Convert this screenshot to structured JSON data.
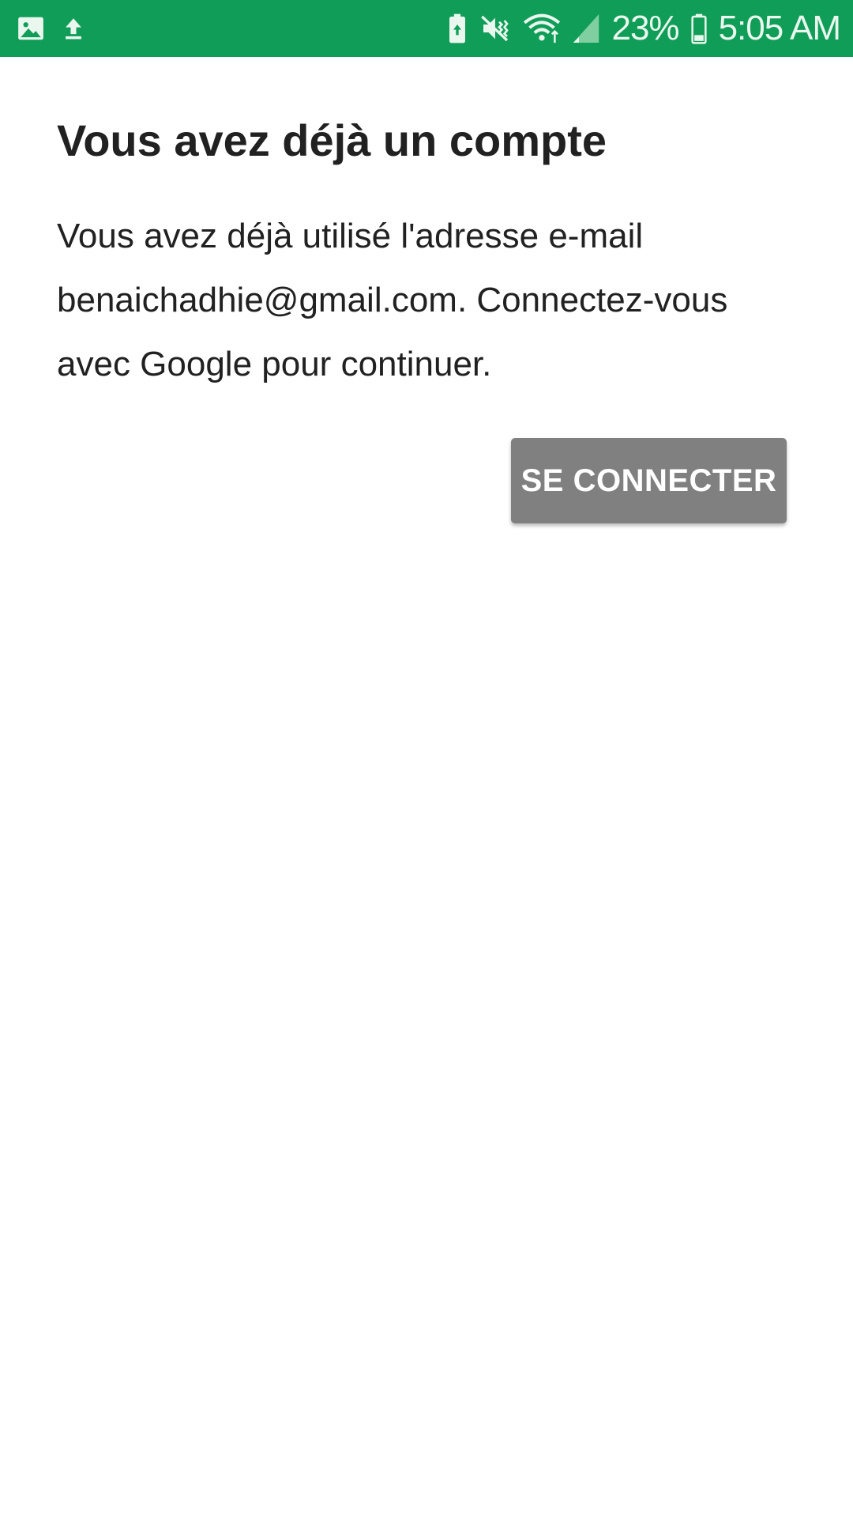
{
  "status_bar": {
    "background_color": "#109d58",
    "left_icons": [
      "gallery-icon",
      "upload-icon"
    ],
    "right_icons": [
      "battery-saver-icon",
      "mute-vibrate-icon",
      "wifi-icon",
      "signal-icon",
      "battery-icon"
    ],
    "battery_percent": "23%",
    "time": "5:05 AM"
  },
  "dialog": {
    "title": "Vous avez déjà un compte",
    "body": "Vous avez déjà utilisé l'adresse e-mail benaichadhie@gmail.com. Connectez-vous avec Google pour continuer.",
    "sign_in_button_label": "SE CONNECTER",
    "button_color": "#808080"
  }
}
